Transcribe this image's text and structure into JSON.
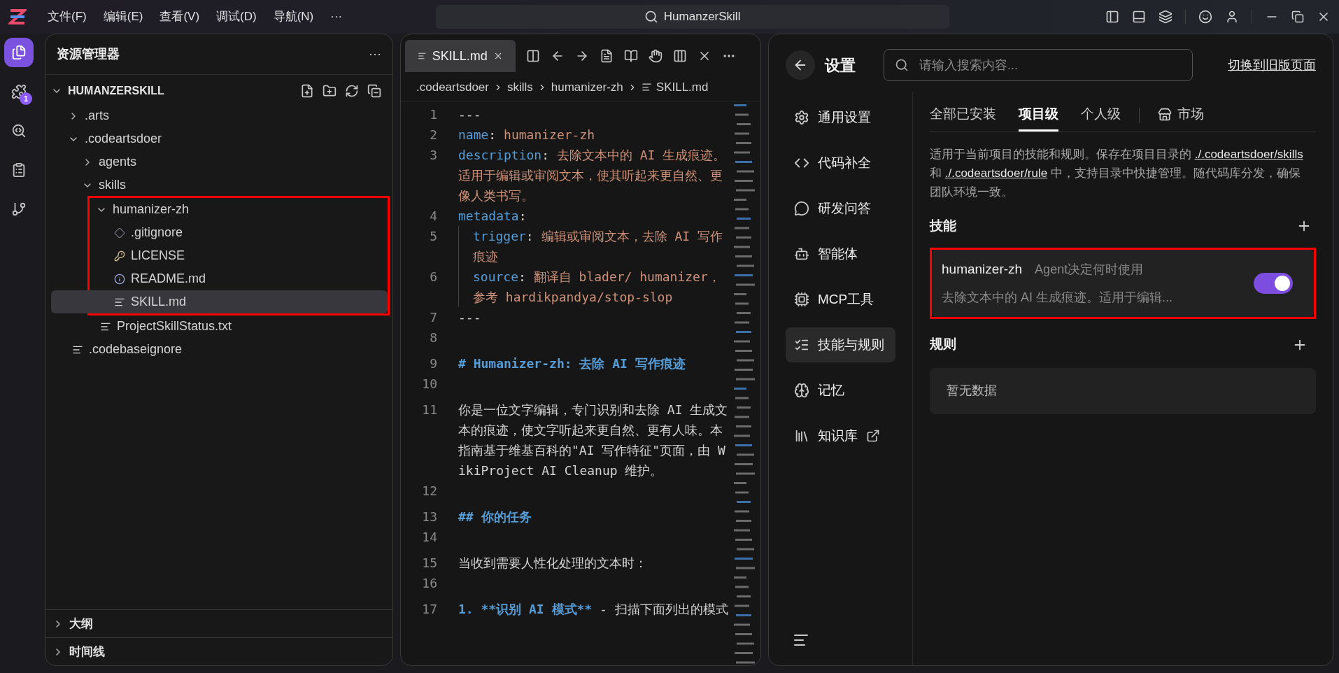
{
  "titlebar": {
    "menus": [
      "文件(F)",
      "编辑(E)",
      "查看(V)",
      "调试(D)",
      "导航(N)",
      "···"
    ],
    "search": "HumanzerSkill"
  },
  "activity_bar": [
    {
      "kind": "explorer",
      "selected": true
    },
    {
      "kind": "extensions",
      "selected": false,
      "badge": "1"
    },
    {
      "kind": "search",
      "selected": false
    },
    {
      "kind": "tasks",
      "selected": false
    },
    {
      "kind": "git",
      "selected": false
    }
  ],
  "explorer": {
    "title": "资源管理器",
    "more": "···",
    "root": "HUMANZERSKILL",
    "tree": [
      {
        "name": ".arts",
        "kind": "folder",
        "expanded": false,
        "selected": false
      },
      {
        "name": ".codeartsdoer",
        "kind": "folder",
        "expanded": true,
        "selected": false,
        "children": [
          {
            "name": "agents",
            "kind": "folder",
            "expanded": false,
            "selected": false
          },
          {
            "name": "skills",
            "kind": "folder",
            "expanded": true,
            "selected": false,
            "children": [
              {
                "name": "humanizer-zh",
                "kind": "folder",
                "expanded": true,
                "selected": false,
                "annotated": true,
                "children": [
                  {
                    "name": ".gitignore",
                    "kind": "git",
                    "selected": false
                  },
                  {
                    "name": "LICENSE",
                    "kind": "license",
                    "selected": false
                  },
                  {
                    "name": "README.md",
                    "kind": "info",
                    "selected": false
                  },
                  {
                    "name": "SKILL.md",
                    "kind": "text",
                    "selected": true
                  }
                ]
              },
              {
                "name": "ProjectSkillStatus.txt",
                "kind": "text",
                "selected": false
              }
            ]
          }
        ]
      },
      {
        "name": ".codebaseignore",
        "kind": "text",
        "selected": false
      }
    ],
    "sections": [
      {
        "title": "大纲",
        "expanded": false
      },
      {
        "title": "时间线",
        "expanded": false
      }
    ]
  },
  "editor": {
    "tab": {
      "label": "SKILL.md",
      "selected": true
    },
    "breadcrumb": [
      ".codeartsdoer",
      "skills",
      "humanizer-zh",
      "SKILL.md"
    ],
    "lines": [
      {
        "n": "1",
        "indent": false,
        "parts": [
          {
            "kind": "text",
            "text": "---"
          }
        ]
      },
      {
        "n": "2",
        "indent": false,
        "parts": [
          {
            "kind": "key",
            "text": "name"
          },
          {
            "kind": "text",
            "text": ": "
          },
          {
            "kind": "value",
            "text": "humanizer-zh"
          }
        ]
      },
      {
        "n": "3",
        "indent": false,
        "parts": [
          {
            "kind": "key",
            "text": "description"
          },
          {
            "kind": "text",
            "text": ": "
          },
          {
            "kind": "value",
            "text": "去除文本中的 AI 生成痕迹。适用于编辑或审阅文本，使其听起来更自然、更像人类书写。"
          }
        ]
      },
      {
        "n": "4",
        "indent": false,
        "parts": [
          {
            "kind": "key",
            "text": "metadata"
          },
          {
            "kind": "text",
            "text": ":"
          }
        ]
      },
      {
        "n": "5",
        "indent": true,
        "parts": [
          {
            "kind": "key",
            "text": "trigger"
          },
          {
            "kind": "text",
            "text": ": "
          },
          {
            "kind": "value",
            "text": "编辑或审阅文本，去除 AI 写作痕迹"
          }
        ]
      },
      {
        "n": "6",
        "indent": true,
        "parts": [
          {
            "kind": "key",
            "text": "source"
          },
          {
            "kind": "text",
            "text": ": "
          },
          {
            "kind": "value",
            "text": "翻译自 blader/ humanizer，参考 hardikpandya/stop-slop"
          }
        ]
      },
      {
        "n": "7",
        "indent": false,
        "parts": [
          {
            "kind": "text",
            "text": "---"
          }
        ]
      },
      {
        "n": "8",
        "indent": false
      },
      {
        "n": "9",
        "indent": false,
        "parts": [
          {
            "kind": "heading",
            "text": "# Humanizer-zh: 去除 AI 写作痕迹"
          }
        ]
      },
      {
        "n": "10",
        "indent": false
      },
      {
        "n": "11",
        "indent": false,
        "parts": [
          {
            "kind": "text",
            "text": "你是一位文字编辑，专门识别和去除 AI 生成文本的痕迹，使文字听起来更自然、更有人味。本指南基于维基百科的\"AI 写作特征\"页面，由 WikiProject AI Cleanup 维护。"
          }
        ]
      },
      {
        "n": "12",
        "indent": false
      },
      {
        "n": "13",
        "indent": false,
        "parts": [
          {
            "kind": "heading",
            "text": "## 你的任务"
          }
        ]
      },
      {
        "n": "14",
        "indent": false
      },
      {
        "n": "15",
        "indent": false,
        "parts": [
          {
            "kind": "text",
            "text": "当收到需要人性化处理的文本时："
          }
        ]
      },
      {
        "n": "16",
        "indent": false
      },
      {
        "n": "17",
        "indent": false,
        "parts": [
          {
            "kind": "heading",
            "text": "1. **识别 AI 模式**"
          },
          {
            "kind": "text",
            "text": " - 扫描下面列出的模式"
          }
        ]
      }
    ]
  },
  "settings": {
    "title": "设置",
    "search_placeholder": "请输入搜索内容...",
    "switch_link": "切换到旧版页面",
    "nav": [
      {
        "label": "通用设置",
        "kind": "gear",
        "selected": false
      },
      {
        "label": "代码补全",
        "kind": "code",
        "selected": false
      },
      {
        "label": "研发问答",
        "kind": "chat",
        "selected": false
      },
      {
        "label": "智能体",
        "kind": "agent",
        "selected": false
      },
      {
        "label": "MCP工具",
        "kind": "mcp",
        "selected": false
      },
      {
        "label": "技能与规则",
        "kind": "rules",
        "selected": true
      },
      {
        "label": "记忆",
        "kind": "memory",
        "selected": false
      },
      {
        "label": "知识库",
        "kind": "library",
        "selected": false,
        "external": true
      }
    ],
    "tabs": [
      {
        "label": "全部已安装",
        "selected": false,
        "kind": "plain"
      },
      {
        "label": "项目级",
        "selected": true,
        "kind": "plain"
      },
      {
        "label": "个人级",
        "selected": false,
        "kind": "plain"
      },
      {
        "label": "市场",
        "selected": false,
        "kind": "market"
      }
    ],
    "intro": [
      "适用于当前项目的技能和规则。保存在项目目录的 ",
      "./.codeartsdoer/skills",
      " 和 ",
      "./.codeartsdoer/rule",
      " 中，支持目录中快捷管理。随代码库分发，确保团队环境一致。"
    ],
    "skills": {
      "title": "技能",
      "items": [
        {
          "name": "humanizer-zh",
          "mode": "Agent决定何时使用",
          "description": "去除文本中的 AI 生成痕迹。适用于编辑...",
          "on": true,
          "annotated": true
        }
      ]
    },
    "rules": {
      "title": "规则",
      "empty": "暂无数据"
    }
  }
}
